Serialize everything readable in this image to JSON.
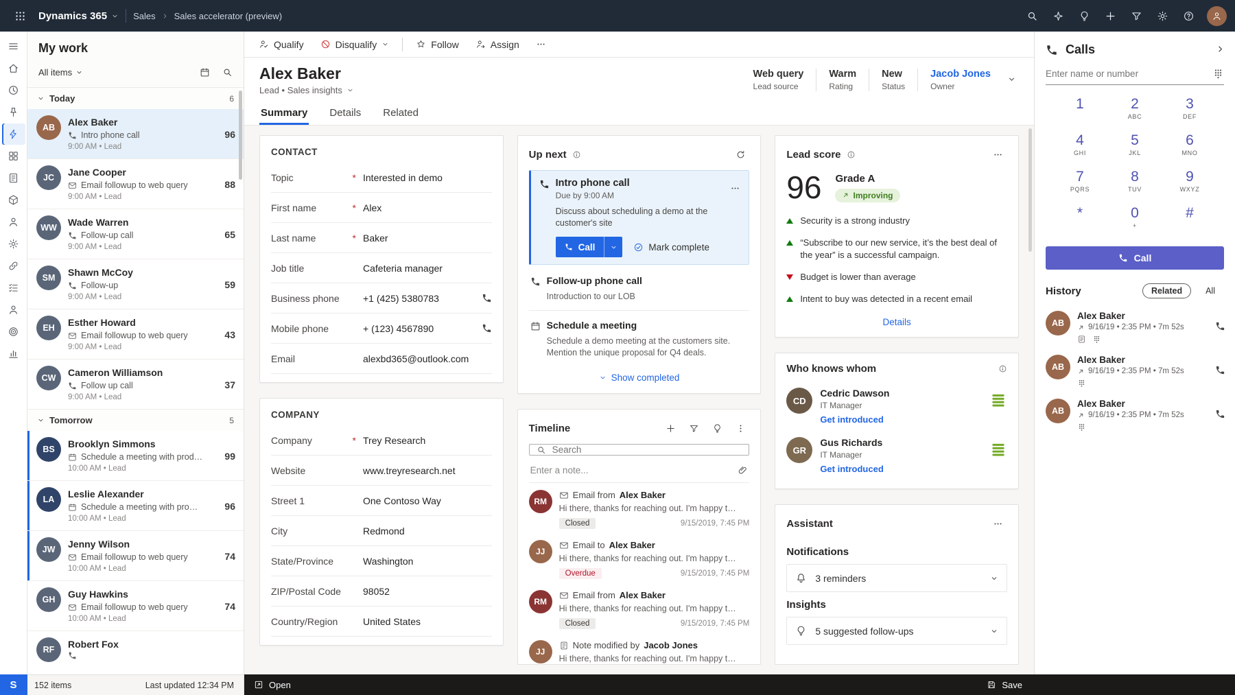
{
  "theme": {
    "accent": "#2266e3",
    "navbar_bg": "#212b38",
    "dialer_button": "#5b5fc7",
    "positive": "#107c10",
    "negative": "#c50f1f",
    "overdue_text": "#b01427"
  },
  "topbar": {
    "brand": "Dynamics 365",
    "breadcrumb": {
      "area": "Sales",
      "subarea": "Sales accelerator (preview)"
    },
    "right_icon_names": [
      "search-icon",
      "insights-icon",
      "suggestions-icon",
      "quick-create-icon",
      "filter-icon",
      "settings-icon",
      "help-icon",
      "user-avatar"
    ]
  },
  "rail": {
    "badge": "S",
    "items": [
      {
        "icon": "menu",
        "name": "nav-menu-button",
        "cls": ""
      },
      {
        "icon": "home",
        "name": "nav-home-button",
        "cls": ""
      },
      {
        "icon": "clock",
        "name": "nav-recent-button",
        "cls": ""
      },
      {
        "icon": "pin",
        "name": "nav-pinned-button",
        "cls": ""
      },
      {
        "icon": "bolt",
        "name": "nav-sales-accelerator-button",
        "cls": "active"
      },
      {
        "icon": "grid",
        "name": "nav-dashboards-button",
        "cls": ""
      },
      {
        "icon": "note",
        "name": "nav-activities-button",
        "cls": ""
      },
      {
        "icon": "box",
        "name": "nav-products-button",
        "cls": ""
      },
      {
        "icon": "person",
        "name": "nav-contacts-button",
        "cls": ""
      },
      {
        "icon": "gear",
        "name": "nav-admin-button",
        "cls": ""
      },
      {
        "icon": "link",
        "name": "nav-connections-button",
        "cls": ""
      },
      {
        "icon": "checklist",
        "name": "nav-tasks-button",
        "cls": ""
      },
      {
        "icon": "person",
        "name": "nav-accounts-button",
        "cls": ""
      },
      {
        "icon": "target",
        "name": "nav-goals-button",
        "cls": ""
      },
      {
        "icon": "chart",
        "name": "nav-reports-button",
        "cls": ""
      }
    ]
  },
  "worklist": {
    "title": "My work",
    "filter_label": "All items",
    "groups": [
      {
        "label": "Today",
        "count": "6"
      },
      {
        "label": "Tomorrow",
        "count": "5"
      }
    ],
    "today_items": [
      {
        "name": "Alex Baker",
        "icon": "phone",
        "activity": "Intro phone call",
        "score": "96",
        "meta": "9:00 AM • Lead",
        "avatar_initials": "AB",
        "avatar_color": "#99674b",
        "row_class": "selected"
      },
      {
        "name": "Jane Cooper",
        "icon": "mail",
        "activity": "Email followup to web query",
        "score": "88",
        "meta": "9:00 AM • Lead",
        "avatar_initials": "JC",
        "avatar_color": "#5a6678"
      },
      {
        "name": "Wade Warren",
        "icon": "phone",
        "activity": "Follow-up call",
        "score": "65",
        "meta": "9:00 AM • Lead",
        "avatar_initials": "WW",
        "avatar_color": "#5a6678"
      },
      {
        "name": "Shawn McCoy",
        "icon": "phone",
        "activity": "Follow-up",
        "score": "59",
        "meta": "9:00 AM • Lead",
        "avatar_initials": "SM",
        "avatar_color": "#5a6678"
      },
      {
        "name": "Esther Howard",
        "icon": "mail",
        "activity": "Email followup to web query",
        "score": "43",
        "meta": "9:00 AM • Lead",
        "avatar_initials": "EH",
        "avatar_color": "#5a6678"
      },
      {
        "name": "Cameron Williamson",
        "icon": "phone",
        "activity": "Follow up call",
        "score": "37",
        "meta": "9:00 AM • Lead",
        "avatar_initials": "CW",
        "avatar_color": "#5a6678"
      }
    ],
    "tomorrow_items": [
      {
        "name": "Brooklyn Simmons",
        "icon": "calendar",
        "activity": "Schedule a meeting with prod…",
        "score": "99",
        "meta": "10:00 AM • Lead",
        "avatar_initials": "BS",
        "avatar_color": "#2f4468",
        "row_class": "accent"
      },
      {
        "name": "Leslie Alexander",
        "icon": "calendar",
        "activity": "Schedule a meeting with pro…",
        "score": "96",
        "meta": "10:00 AM • Lead",
        "avatar_initials": "LA",
        "avatar_color": "#2f4468",
        "row_class": "accent"
      },
      {
        "name": "Jenny Wilson",
        "icon": "mail",
        "activity": "Email followup to web query",
        "score": "74",
        "meta": "10:00 AM • Lead",
        "avatar_initials": "JW",
        "avatar_color": "#5a6678",
        "row_class": "accent"
      },
      {
        "name": "Guy Hawkins",
        "icon": "mail",
        "activity": "Email followup to web query",
        "score": "74",
        "meta": "10:00 AM • Lead",
        "avatar_initials": "GH",
        "avatar_color": "#5a6678"
      },
      {
        "name": "Robert Fox",
        "icon": "phone",
        "activity": "",
        "score": "",
        "meta": "",
        "avatar_initials": "RF",
        "avatar_color": "#5a6678"
      }
    ],
    "footer": {
      "count": "152 items",
      "updated": "Last updated 12:34 PM"
    }
  },
  "commandbar": {
    "qualify": "Qualify",
    "disqualify": "Disqualify",
    "follow": "Follow",
    "assign": "Assign"
  },
  "lead": {
    "name": "Alex Baker",
    "subtitle": "Lead • Sales insights",
    "stats": [
      {
        "value": "Web query",
        "label": "Lead source",
        "value_class": ""
      },
      {
        "value": "Warm",
        "label": "Rating",
        "value_class": ""
      },
      {
        "value": "New",
        "label": "Status",
        "value_class": ""
      },
      {
        "value": "Jacob Jones",
        "label": "Owner",
        "value_class": "link"
      }
    ],
    "tabs": [
      {
        "label": "Summary",
        "cls": "active",
        "name": "tab-summary"
      },
      {
        "label": "Details",
        "cls": "",
        "name": "tab-details"
      },
      {
        "label": "Related",
        "cls": "",
        "name": "tab-related"
      }
    ]
  },
  "contact": {
    "title": "CONTACT",
    "fields": [
      {
        "label": "Topic",
        "req": "req",
        "value": "Interested in demo"
      },
      {
        "label": "First name",
        "req": "req",
        "value": "Alex"
      },
      {
        "label": "Last name",
        "req": "req",
        "value": "Baker"
      },
      {
        "label": "Job title",
        "value": "Cafeteria manager"
      },
      {
        "label": "Business phone",
        "value": "+1 (425) 5380783",
        "icon": "phone"
      },
      {
        "label": "Mobile phone",
        "value": "+ (123) 4567890",
        "icon": "phone"
      },
      {
        "label": "Email",
        "value": "alexbd365@outlook.com"
      }
    ]
  },
  "company": {
    "title": "COMPANY",
    "fields": [
      {
        "label": "Company",
        "req": "req",
        "value": "Trey Research"
      },
      {
        "label": "Website",
        "value": "www.treyresearch.net"
      },
      {
        "label": "Street 1",
        "value": "One Contoso Way"
      },
      {
        "label": "City",
        "value": "Redmond"
      },
      {
        "label": "State/Province",
        "value": "Washington"
      },
      {
        "label": "ZIP/Postal Code",
        "value": "98052"
      },
      {
        "label": "Country/Region",
        "value": "United States"
      }
    ]
  },
  "upnext": {
    "title": "Up next",
    "active": {
      "title": "Intro phone call",
      "due": "Due by 9:00 AM",
      "desc": "Discuss about scheduling a demo at the customer's site",
      "call_label": "Call",
      "complete_label": "Mark complete"
    },
    "next": {
      "title": "Follow-up phone call",
      "desc": "Introduction to our LOB"
    },
    "later": {
      "title": "Schedule a meeting",
      "desc": "Schedule a demo meeting at the customers site. Mention the unique proposal for Q4 deals."
    },
    "show_completed": "Show completed"
  },
  "timeline": {
    "title": "Timeline",
    "search_placeholder": "Search",
    "note_placeholder": "Enter a note...",
    "entries": [
      {
        "icon": "mail",
        "action": "Email from",
        "actor": "Alex Baker",
        "preview": "Hi there, thanks for reaching out. I'm happy t…",
        "badge": "Closed",
        "badge_class": "closed",
        "date": "9/15/2019, 7:45 PM",
        "avatar_initials": "RM",
        "avatar_color": "#8a3433"
      },
      {
        "icon": "mail",
        "action": "Email to",
        "actor": "Alex Baker",
        "preview": "Hi there, thanks for reaching out. I'm happy t…",
        "badge": "Overdue",
        "badge_class": "overdue",
        "date": "9/15/2019, 7:45 PM",
        "avatar_initials": "JJ",
        "avatar_color": "#99674b"
      },
      {
        "icon": "mail",
        "action": "Email from",
        "actor": "Alex Baker",
        "preview": "Hi there, thanks for reaching out. I'm happy t…",
        "badge": "Closed",
        "badge_class": "closed",
        "date": "9/15/2019, 7:45 PM",
        "avatar_initials": "RM",
        "avatar_color": "#8a3433"
      },
      {
        "icon": "note",
        "action": "Note modified by",
        "actor": "Jacob Jones",
        "preview": "Hi there, thanks for reaching out. I'm happy t…",
        "badge": "",
        "badge_class": "",
        "date": "",
        "avatar_initials": "JJ",
        "avatar_color": "#99674b"
      }
    ]
  },
  "leadscore": {
    "title": "Lead score",
    "score": "96",
    "grade": "Grade A",
    "trend": "Improving",
    "factors": [
      {
        "dir": "up",
        "text": "Security is a strong industry"
      },
      {
        "dir": "up",
        "text": "“Subscribe to our new service, it’s the best deal of the year” is a successful campaign."
      },
      {
        "dir": "down",
        "text": "Budget is lower than average"
      },
      {
        "dir": "up",
        "text": "Intent to buy was detected in a recent email"
      }
    ],
    "details_label": "Details"
  },
  "whoknows": {
    "title": "Who knows whom",
    "people": [
      {
        "name": "Cedric Dawson",
        "role": "IT Manager",
        "action": "Get introduced",
        "avatar_initials": "CD",
        "avatar_color": "#6b5948"
      },
      {
        "name": "Gus Richards",
        "role": "IT Manager",
        "action": "Get introduced",
        "avatar_initials": "GR",
        "avatar_color": "#7d6a50"
      }
    ]
  },
  "assistant": {
    "title": "Assistant",
    "notifications_label": "Notifications",
    "notifications": [
      {
        "icon": "bell",
        "text": "3 reminders"
      }
    ],
    "insights_label": "Insights",
    "insights": [
      {
        "icon": "bulb",
        "text": "5 suggested follow-ups"
      }
    ]
  },
  "calls": {
    "title": "Calls",
    "input_placeholder": "Enter name or number",
    "keys": [
      {
        "digit": "1",
        "letters": ""
      },
      {
        "digit": "2",
        "letters": "ABC"
      },
      {
        "digit": "3",
        "letters": "DEF"
      },
      {
        "digit": "4",
        "letters": "GHI"
      },
      {
        "digit": "5",
        "letters": "JKL"
      },
      {
        "digit": "6",
        "letters": "MNO"
      },
      {
        "digit": "7",
        "letters": "PQRS"
      },
      {
        "digit": "8",
        "letters": "TUV"
      },
      {
        "digit": "9",
        "letters": "WXYZ"
      },
      {
        "digit": "*",
        "letters": ""
      },
      {
        "digit": "0",
        "letters": "+"
      },
      {
        "digit": "#",
        "letters": ""
      }
    ],
    "call_label": "Call",
    "history_label": "History",
    "filters": [
      {
        "label": "Related",
        "cls": "active"
      },
      {
        "label": "All",
        "cls": ""
      }
    ],
    "entries": [
      {
        "name": "Alex Baker",
        "meta": "9/16/19 • 2:35 PM • 7m 52s",
        "avatar_initials": "AB",
        "avatar_color": "#99674b",
        "icon1": "note",
        "icon2": "dialpad"
      },
      {
        "name": "Alex Baker",
        "meta": "9/16/19 • 2:35 PM • 7m 52s",
        "avatar_initials": "AB",
        "avatar_color": "#99674b",
        "icon1": "dialpad"
      },
      {
        "name": "Alex Baker",
        "meta": "9/16/19 • 2:35 PM • 7m 52s",
        "avatar_initials": "AB",
        "avatar_color": "#99674b",
        "icon1": "dialpad"
      }
    ]
  },
  "statusbar": {
    "open_label": "Open",
    "save_label": "Save"
  }
}
